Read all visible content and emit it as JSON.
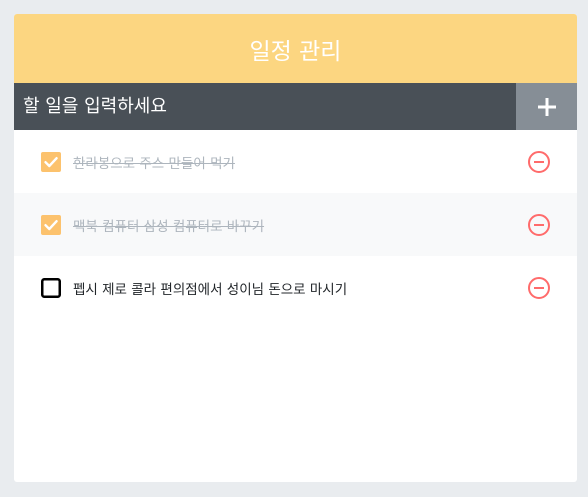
{
  "header": {
    "title": "일정 관리"
  },
  "insert": {
    "placeholder": "할 일을 입력하세요",
    "value": "",
    "submit_icon": "plus-icon"
  },
  "todos": [
    {
      "text": "한라봉으로 주스 만들어 먹기",
      "checked": true
    },
    {
      "text": "맥북 컴퓨터 삼성 컴퓨터로 바꾸기",
      "checked": true
    },
    {
      "text": "펩시 제로 콜라 편의점에서 성이님 돈으로 마시기",
      "checked": false
    }
  ],
  "colors": {
    "page_background": "#e9ecef",
    "header": "#fcd681",
    "insert_bar": "#495057",
    "submit_button": "#868e96",
    "checked": "#fcc26d",
    "remove": "#ff6b6b",
    "done_text": "#adb5bd"
  }
}
